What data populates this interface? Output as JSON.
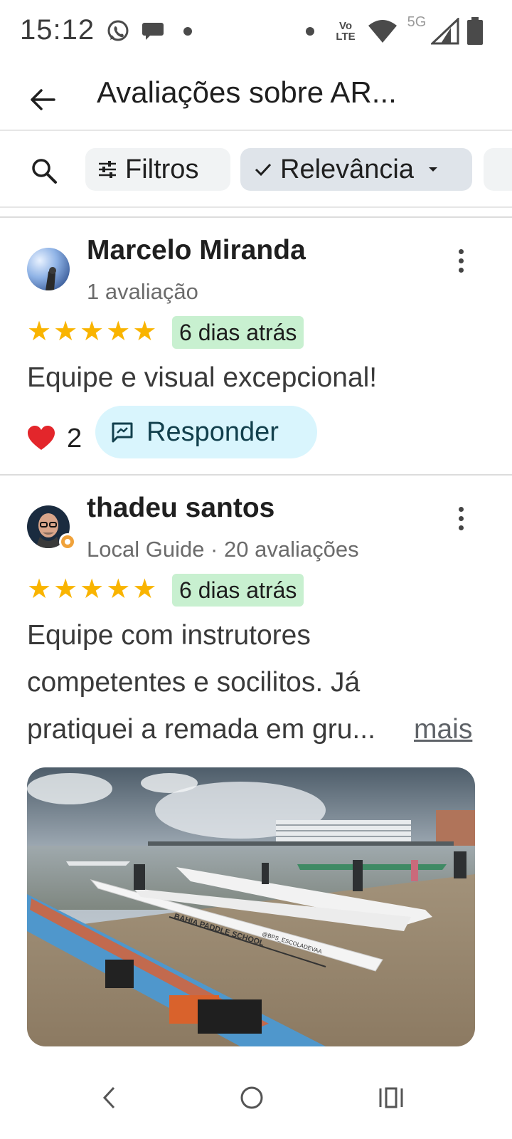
{
  "status_bar": {
    "time": "15:12",
    "icons": [
      "whatsapp-icon",
      "chat-icon",
      "dot-icon",
      "volte-icon",
      "wifi-icon",
      "5g-icon",
      "signal-icon",
      "battery-icon"
    ],
    "volte": "Vo LTE",
    "network": "5G"
  },
  "app_bar": {
    "title": "Avaliações sobre AR..."
  },
  "filter_bar": {
    "filters_label": "Filtros",
    "sort_label": "Relevância"
  },
  "reviews": [
    {
      "author": "Marcelo Miranda",
      "meta": "1 avaliação",
      "rating": 5,
      "date": "6 dias atrás",
      "text": "Equipe e visual excepcional!",
      "likes": "2",
      "reply_label": "Responder"
    },
    {
      "author": "thadeu santos",
      "meta": "Local Guide · 20 avaliações",
      "rating": 5,
      "date": "6 dias atrás",
      "text_lines": [
        "Equipe com instrutores",
        "competentes e socilitos. Já",
        "pratiquei a remada em gru..."
      ],
      "more_label": "mais",
      "photo_text": [
        "BAHIA PADDLE SCHOOL",
        "@BPS_ESCOLADEVAA"
      ]
    }
  ],
  "colors": {
    "star": "#f9b400",
    "date_badge": "#c8f0d0",
    "reply_button": "#d9f5fd",
    "sort_chip": "#dfe4ea",
    "filter_chip": "#f1f3f4"
  }
}
